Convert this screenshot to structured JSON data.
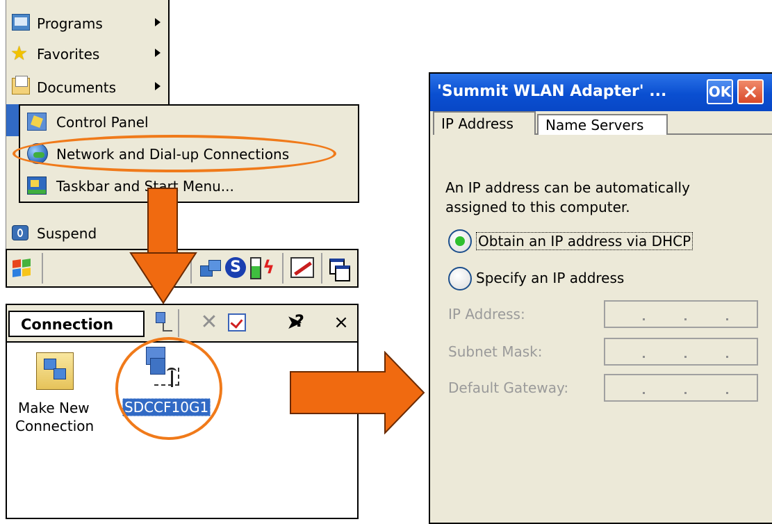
{
  "start_menu": {
    "items": [
      {
        "label": "Programs",
        "accel": "P",
        "icon": "programs-folder-icon"
      },
      {
        "label": "Favorites",
        "accel": "a",
        "icon": "star-icon"
      },
      {
        "label": "Documents",
        "accel": "D",
        "icon": "documents-icon"
      },
      {
        "label": "Suspend",
        "accel": "u",
        "icon": "suspend-icon"
      }
    ],
    "settings_submenu": [
      {
        "label": "Control Panel",
        "icon": "control-panel-icon"
      },
      {
        "label": "Network and Dial-up Connections",
        "icon": "network-globe-icon"
      },
      {
        "label": "Taskbar and Start Menu...",
        "icon": "taskbar-icon"
      }
    ]
  },
  "taskbar": {
    "tray_icons": [
      "network-computers-icon",
      "s-status-icon",
      "battery-charging-icon",
      "pen-icon",
      "windows-cascade-icon"
    ]
  },
  "connection_window": {
    "menu_label": "Connection",
    "toolbar_icons": [
      "new-connection-icon",
      "delete-icon",
      "properties-icon",
      "help-icon",
      "close-icon"
    ],
    "close_label": "×",
    "help_label": "?",
    "items": [
      {
        "label_line1": "Make New",
        "label_line2": "Connection",
        "icon": "make-new-connection-icon"
      },
      {
        "label": "SDCCF10G1",
        "icon": "network-adapter-icon"
      }
    ]
  },
  "dialog": {
    "title": "'Summit WLAN Adapter' ...",
    "ok_label": "OK",
    "close_label": "×",
    "tabs": [
      {
        "label": "IP Address",
        "active": true
      },
      {
        "label": "Name Servers",
        "active": false
      }
    ],
    "description_line1": "An IP address can be automatically",
    "description_line2": "assigned to this computer.",
    "options": [
      {
        "label": "Obtain an IP address via DHCP",
        "selected": true
      },
      {
        "label": "Specify an IP address",
        "selected": false
      }
    ],
    "fields": [
      {
        "label": "IP Address:",
        "value": ""
      },
      {
        "label": "Subnet Mask:",
        "value": ""
      },
      {
        "label": "Default Gateway:",
        "value": ""
      }
    ]
  },
  "colors": {
    "arrow": "#f06a10",
    "highlight": "#f07a1a",
    "title_bar": "#0a4fd1",
    "selection": "#316ac5",
    "dhcp_dot": "#2fbf2f"
  }
}
